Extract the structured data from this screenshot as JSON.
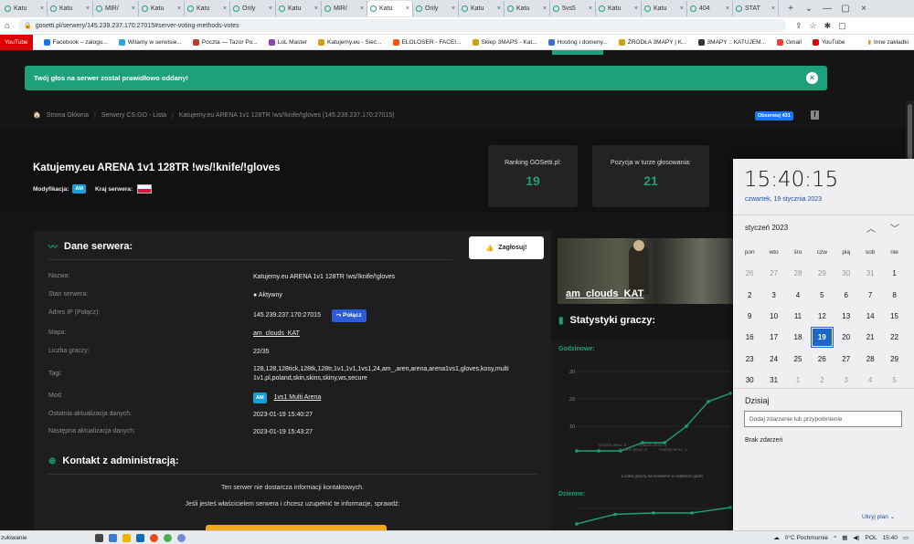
{
  "browser": {
    "tabs": [
      {
        "label": "Katu",
        "active": false
      },
      {
        "label": "Katu",
        "active": false
      },
      {
        "label": "MIR/",
        "active": false
      },
      {
        "label": "Katu",
        "active": false
      },
      {
        "label": "Katu",
        "active": false
      },
      {
        "label": "Only",
        "active": false
      },
      {
        "label": "Katu",
        "active": false
      },
      {
        "label": "MIR/",
        "active": false
      },
      {
        "label": "Katu",
        "active": true
      },
      {
        "label": "Only",
        "active": false
      },
      {
        "label": "Katu",
        "active": false
      },
      {
        "label": "Katu",
        "active": false
      },
      {
        "label": "5vs5",
        "active": false
      },
      {
        "label": "Katu",
        "active": false
      },
      {
        "label": "Katu",
        "active": false
      },
      {
        "label": "404",
        "active": false
      },
      {
        "label": "STAT",
        "active": false
      }
    ],
    "url": "gosetti.pl/serwery/145.239.237.170:27015#server-voting-methods-votes",
    "bookmarks": [
      {
        "label": "YouTube",
        "color": "#d00"
      },
      {
        "label": "Facebook – zalogu...",
        "color": "#1877f2"
      },
      {
        "label": "Witamy w serwisie...",
        "color": "#2aa3e0"
      },
      {
        "label": "Poczta — Tazor Po...",
        "color": "#c0392b"
      },
      {
        "label": "LoL Master",
        "color": "#8e44ad"
      },
      {
        "label": "Katujemy.eu - Sieć...",
        "color": "#d4a017"
      },
      {
        "label": "ELOLOSER - FACEI...",
        "color": "#ff5500"
      },
      {
        "label": "Sklep 3MAPS - Kat...",
        "color": "#d4a017"
      },
      {
        "label": "Hosting i domeny...",
        "color": "#3b6fd8"
      },
      {
        "label": "ŹRÓDŁA 3MAPY | K...",
        "color": "#d4a017"
      },
      {
        "label": "3MAPY :: KATUJEM...",
        "color": "#333"
      },
      {
        "label": "Gmail",
        "color": "#ea4335"
      },
      {
        "label": "YouTube",
        "color": "#d00"
      }
    ],
    "bookmarks_other": "Inne zakładki"
  },
  "alert": {
    "text": "Twój głos na serwer został prawidłowo oddany!",
    "close": "×"
  },
  "breadcrumb": {
    "home": "Strona Główna",
    "list": "Serwery CS:GO - Lista",
    "current": "Katujemy.eu ARENA 1v1 128TR !ws/!knife/!gloves (145.239.237.170:27015)"
  },
  "social": {
    "fb_follow": "Obserwuj 431"
  },
  "server": {
    "title": "Katujemy.eu ARENA 1v1 128TR !ws/!knife/!gloves",
    "mod_label": "Modyfikacja:",
    "mod_badge": "AM",
    "country_label": "Kraj serwera:"
  },
  "stats": {
    "ranking_label": "Ranking GOSetti.pl:",
    "ranking_value": "19",
    "position_label": "Pozycja w turze głosowania:",
    "position_value": "21"
  },
  "details": {
    "title": "Dane serwera:",
    "vote_button": "Zagłosuj!",
    "rows": [
      {
        "key": "Nazwa:",
        "value": "Katujemy.eu ARENA 1v1 128TR !ws/!knife/!gloves"
      },
      {
        "key": "Stan serwera:",
        "value": "Aktywny"
      },
      {
        "key": "Adres IP (Połącz):",
        "value": "145.239.237.170:27015"
      },
      {
        "key": "Mapa:",
        "value": "am_clouds_KAT"
      },
      {
        "key": "Liczba graczy:",
        "value": "22/35"
      },
      {
        "key": "Tagi:",
        "value": "128,128,128tick,128tk,128tr,1v1,1v1,1vs1,24,am_,aren,arena,arena1vs1,gloves,kosy,multi 1v1,pl,poland,skin,skins,skiny,ws,secure"
      },
      {
        "key": "Mod:",
        "value": "1vs1 Multi Arena"
      },
      {
        "key": "Ostatnia aktualizacja danych:",
        "value": "2023-01-19 15:40:27"
      },
      {
        "key": "Następna aktualizacja danych:",
        "value": "2023-01-19 15:43:27"
      }
    ],
    "connect_button": "Połącz",
    "mod_badge": "AM"
  },
  "contact": {
    "title": "Kontakt z administracją:",
    "line1": "Ten serwer nie dostarcza informacji kontaktowych.",
    "line2": "Jeśli jesteś właścicielem serwera i chcesz uzupełnić te informacje, sprawdź:"
  },
  "map_card": {
    "name": "am_clouds_KAT"
  },
  "player_stats": {
    "title": "Statystyki graczy:",
    "hourly_label": "Godzinowe:",
    "daily_label": "Dzienne:",
    "caption": "Liczba graczy na serwerze w ostatnich godzi",
    "tooltips": [
      "Godzin temu: 4",
      "Godzin temu: 3",
      "Godzin temu: 2",
      "Godzin temu: 1"
    ]
  },
  "chart_data": [
    {
      "type": "line",
      "title": "Godzinowe:",
      "xlabel": "Liczba graczy na serwerze w ostatnich godzi",
      "ylabel": "",
      "y_ticks": [
        10,
        20,
        30
      ],
      "ylim": [
        0,
        30
      ],
      "x": [
        1,
        2,
        3,
        4,
        5,
        6,
        7,
        8
      ],
      "values": [
        1,
        1,
        1,
        4,
        4,
        10,
        19,
        22
      ]
    },
    {
      "type": "line",
      "title": "Dzienne:",
      "x": [
        1,
        2,
        3,
        4,
        5
      ],
      "values": [
        2,
        9,
        10,
        10,
        14
      ]
    }
  ],
  "calendar": {
    "time": "15:40:15",
    "date": "czwartek, 19 stycznia 2023",
    "month": "styczeń 2023",
    "weekdays": [
      "pon",
      "wto",
      "śro",
      "czw",
      "pią",
      "sob",
      "nie"
    ],
    "weeks": [
      [
        "26",
        "27",
        "28",
        "29",
        "30",
        "31",
        "1"
      ],
      [
        "2",
        "3",
        "4",
        "5",
        "6",
        "7",
        "8"
      ],
      [
        "9",
        "10",
        "11",
        "12",
        "13",
        "14",
        "15"
      ],
      [
        "16",
        "17",
        "18",
        "19",
        "20",
        "21",
        "22"
      ],
      [
        "23",
        "24",
        "25",
        "26",
        "27",
        "28",
        "29"
      ],
      [
        "30",
        "31",
        "1",
        "2",
        "3",
        "4",
        "5"
      ]
    ],
    "dim": [
      [
        0,
        0
      ],
      [
        0,
        1
      ],
      [
        0,
        2
      ],
      [
        0,
        3
      ],
      [
        0,
        4
      ],
      [
        0,
        5
      ],
      [
        5,
        2
      ],
      [
        5,
        3
      ],
      [
        5,
        4
      ],
      [
        5,
        5
      ],
      [
        5,
        6
      ]
    ],
    "today": [
      3,
      3
    ],
    "today_label": "Dzisiaj",
    "event_placeholder": "Dodaj zdarzenie lub przypomnienie",
    "no_events": "Brak zdarzeń",
    "hide_plan": "Ukryj plan"
  },
  "taskbar": {
    "search_text": "zukiwanie",
    "weather": "0°C  Pochmurnie",
    "lang": "POL",
    "clock": "15:40"
  }
}
